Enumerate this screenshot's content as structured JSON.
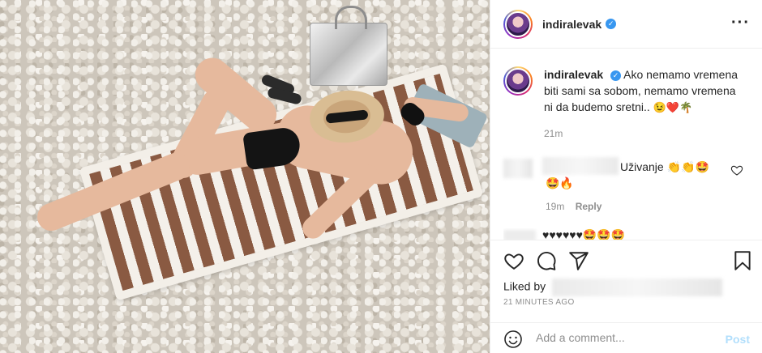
{
  "post": {
    "username": "indiralevak",
    "verified_icon": "verified-badge-icon",
    "more_icon": "more-options-icon",
    "caption": {
      "username": "indiralevak",
      "text": "Ako nemamo vremena biti sami sa sobom, nemamo vremena ni da budemo sretni..",
      "emojis": "😉❤️🌴"
    },
    "caption_time": "21m"
  },
  "comments": [
    {
      "text": "Uživanje",
      "emojis_line1": "👏👏🤩",
      "emojis_line2": "🤩🔥",
      "time": "19m",
      "reply_label": "Reply"
    },
    {
      "text": "♥♥♥♥♥♥🤩🤩🤩"
    }
  ],
  "actions": {
    "like_icon": "heart-icon",
    "comment_icon": "comment-icon",
    "share_icon": "share-icon",
    "save_icon": "bookmark-icon"
  },
  "liked_by_label": "Liked by",
  "timestamp": "21 MINUTES AGO",
  "add_comment": {
    "placeholder": "Add a comment...",
    "post_label": "Post",
    "emoji_icon": "smile-icon"
  },
  "colors": {
    "accent": "#3897f0",
    "post_button_disabled": "#b2dffc",
    "muted_text": "#8e8e8e",
    "border": "#efefef"
  }
}
